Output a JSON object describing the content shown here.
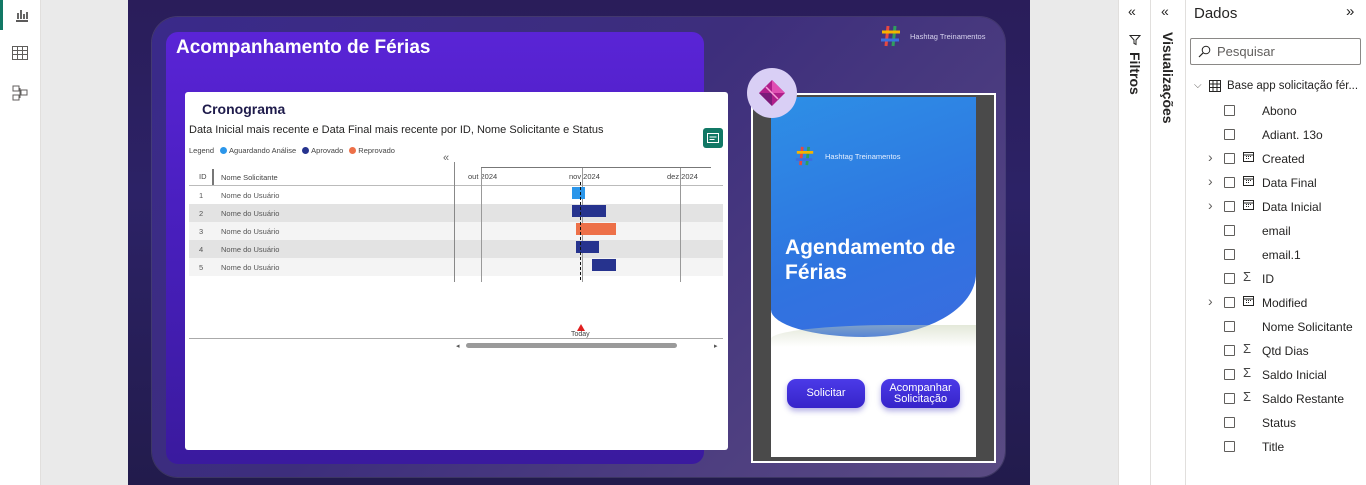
{
  "report": {
    "title": "Acompanhamento de Férias",
    "brand": "Hashtag Treinamentos"
  },
  "visual": {
    "title": "Cronograma",
    "subtitle": "Data Inicial mais recente e Data Final mais recente por ID, Nome Solicitante e Status",
    "legend_label": "Legend",
    "legend": [
      {
        "name": "Aguardando Análise",
        "color": "#2b96ea"
      },
      {
        "name": "Aprovado",
        "color": "#26338e"
      },
      {
        "name": "Reprovado",
        "color": "#ed7048"
      }
    ],
    "col_id": "ID",
    "col_name": "Nome Solicitante",
    "months": [
      "out 2024",
      "nov 2024",
      "dez 2024"
    ],
    "today_label": "Today",
    "rows": [
      {
        "id": "1",
        "name": "Nome do Usuário",
        "status": "Aguardando Análise"
      },
      {
        "id": "2",
        "name": "Nome do Usuário",
        "status": "Aprovado"
      },
      {
        "id": "3",
        "name": "Nome do Usuário",
        "status": "Reprovado"
      },
      {
        "id": "4",
        "name": "Nome do Usuário",
        "status": "Aprovado"
      },
      {
        "id": "5",
        "name": "Nome do Usuário",
        "status": "Aprovado"
      }
    ]
  },
  "app": {
    "brand": "Hashtag Treinamentos",
    "title_line1": "Agendamento de",
    "title_line2": "Férias",
    "btn_request": "Solicitar",
    "btn_follow_line1": "Acompanhar",
    "btn_follow_line2": "Solicitação"
  },
  "panes": {
    "filters": "Filtros",
    "visualizations": "Visualizações",
    "data": "Dados",
    "search_placeholder": "Pesquisar",
    "table_name": "Base app solicitação fér...",
    "fields": [
      {
        "name": "Abono",
        "icon": "",
        "expand": false
      },
      {
        "name": "Adiant. 13o",
        "icon": "",
        "expand": false
      },
      {
        "name": "Created",
        "icon": "calendar-icon",
        "expand": true
      },
      {
        "name": "Data Final",
        "icon": "calendar-icon",
        "expand": true
      },
      {
        "name": "Data Inicial",
        "icon": "calendar-icon",
        "expand": true
      },
      {
        "name": "email",
        "icon": "",
        "expand": false
      },
      {
        "name": "email.1",
        "icon": "",
        "expand": false
      },
      {
        "name": "ID",
        "icon": "sigma-icon",
        "expand": false
      },
      {
        "name": "Modified",
        "icon": "calendar-icon",
        "expand": true
      },
      {
        "name": "Nome Solicitante",
        "icon": "",
        "expand": false
      },
      {
        "name": "Qtd Dias",
        "icon": "sigma-icon",
        "expand": false
      },
      {
        "name": "Saldo Inicial",
        "icon": "sigma-icon",
        "expand": false
      },
      {
        "name": "Saldo Restante",
        "icon": "sigma-icon",
        "expand": false
      },
      {
        "name": "Status",
        "icon": "",
        "expand": false
      },
      {
        "name": "Title",
        "icon": "",
        "expand": false
      }
    ]
  }
}
